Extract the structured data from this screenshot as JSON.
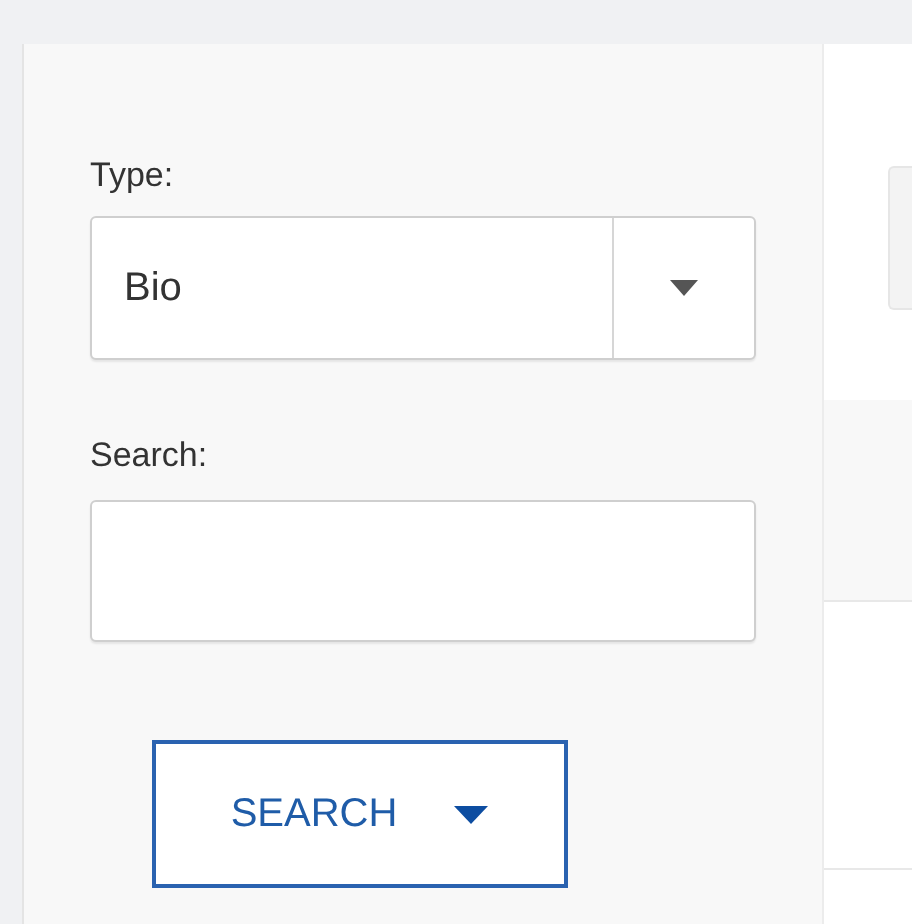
{
  "filters": {
    "type_label": "Type:",
    "type_value": "Bio",
    "search_label": "Search:"
  },
  "search_button": {
    "label": "SEARCH"
  }
}
